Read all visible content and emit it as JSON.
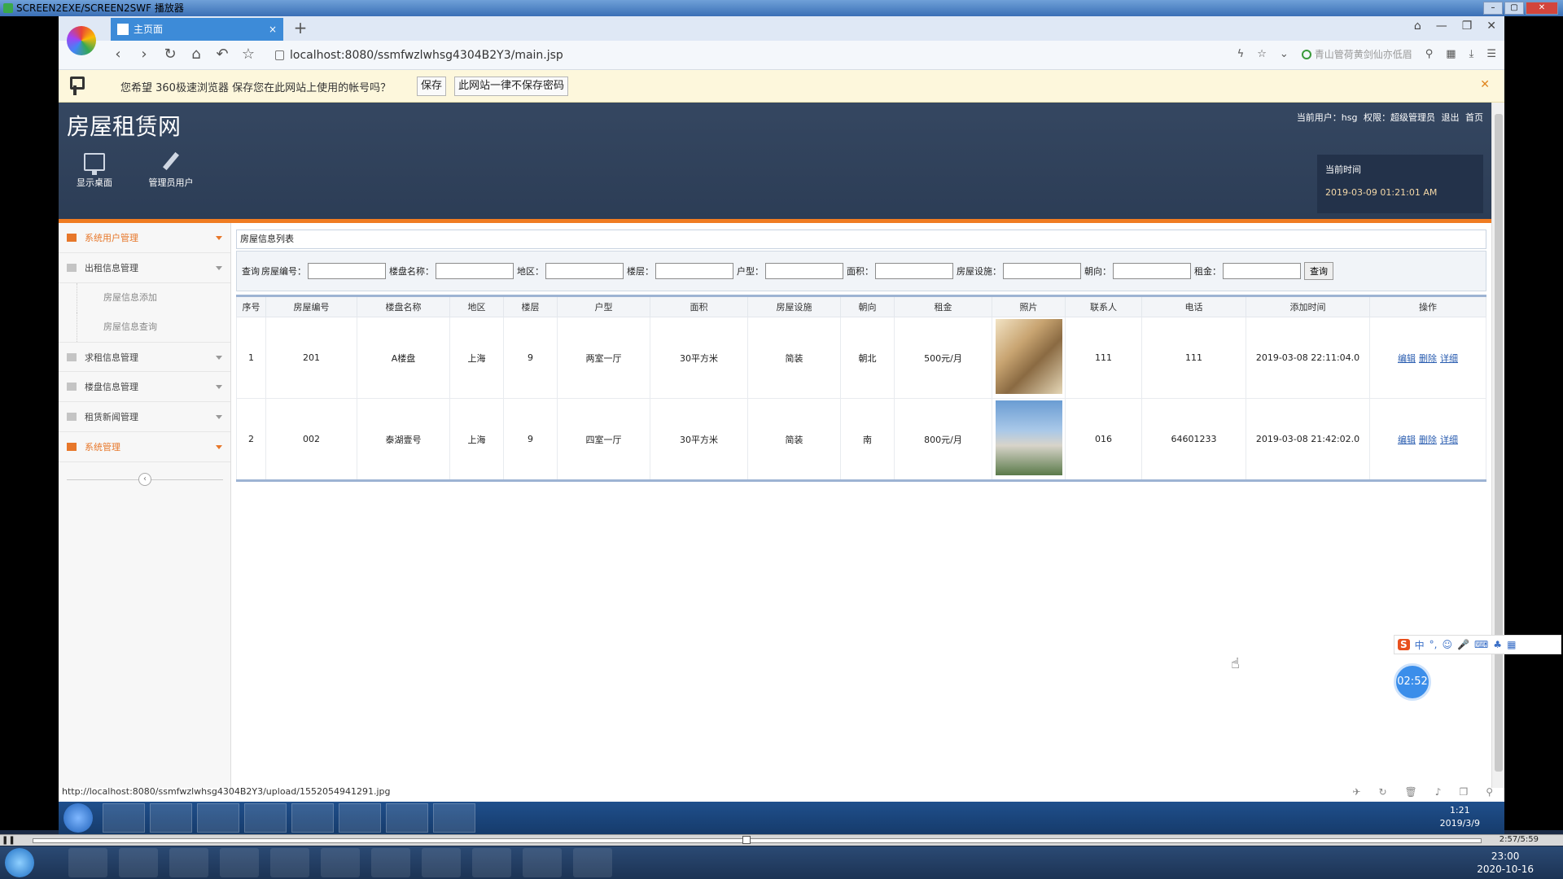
{
  "player": {
    "title": "SCREEN2EXE/SCREEN2SWF 播放器"
  },
  "browser": {
    "tab_title": "主页面",
    "url": "localhost:8080/ssmfwzlwhsg4304B2Y3/main.jsp",
    "search_hint": "青山管荷黄剑仙亦低眉",
    "password_prompt": {
      "message": "您希望 360极速浏览器 保存您在此网站上使用的帐号吗？",
      "save_label": "保存",
      "never_label": "此网站一律不保存密码"
    },
    "status_url": "http://localhost:8080/ssmfwzlwhsg4304B2Y3/upload/1552054941291.jpg"
  },
  "site": {
    "title": "房屋租赁网",
    "user_info": {
      "current_user": "当前用户：hsg",
      "role": "权限：超级管理员",
      "logout": "退出",
      "home": "首页"
    },
    "header_buttons": [
      {
        "label": "显示桌面",
        "icon": "monitor-icon"
      },
      {
        "label": "管理员用户",
        "icon": "pencil-icon"
      }
    ],
    "time_box": {
      "label": "当前时间",
      "value": "2019-03-09 01:21:01 AM"
    }
  },
  "sidebar": {
    "items": [
      {
        "label": "系统用户管理",
        "active": true
      },
      {
        "label": "出租信息管理",
        "active": false
      },
      {
        "label": "求租信息管理",
        "active": false
      },
      {
        "label": "楼盘信息管理",
        "active": false
      },
      {
        "label": "租赁新闻管理",
        "active": false
      },
      {
        "label": "系统管理",
        "active": true
      }
    ],
    "subitems": [
      "房屋信息添加",
      "房屋信息查询"
    ]
  },
  "main": {
    "panel_title": "房屋信息列表",
    "query": {
      "prefix": "查询",
      "fields": [
        "房屋编号：",
        "楼盘名称：",
        "地区：",
        "楼层：",
        "户型：",
        "面积：",
        "房屋设施：",
        "朝向：",
        "租金："
      ],
      "button": "查询"
    },
    "table": {
      "headers": [
        "序号",
        "房屋编号",
        "楼盘名称",
        "地区",
        "楼层",
        "户型",
        "面积",
        "房屋设施",
        "朝向",
        "租金",
        "照片",
        "联系人",
        "电话",
        "添加时间",
        "操作"
      ],
      "rows": [
        {
          "no": "1",
          "code": "201",
          "building": "A楼盘",
          "region": "上海",
          "floor": "9",
          "layout": "两室一厅",
          "area": "30平方米",
          "facility": "简装",
          "orientation": "朝北",
          "rent": "500元/月",
          "contact": "111",
          "phone": "111",
          "added": "2019-03-08 22:11:04.0"
        },
        {
          "no": "2",
          "code": "002",
          "building": "泰湖壹号",
          "region": "上海",
          "floor": "9",
          "layout": "四室一厅",
          "area": "30平方米",
          "facility": "简装",
          "orientation": "南",
          "rent": "800元/月",
          "contact": "016",
          "phone": "64601233",
          "added": "2019-03-08 21:42:02.0"
        }
      ],
      "ops": {
        "edit": "编辑",
        "delete": "删除",
        "detail": "详细"
      }
    }
  },
  "overlay": {
    "timer": "02:52",
    "ime_label": "中"
  },
  "inner_clock": {
    "time": "1:21",
    "date": "2019/3/9"
  },
  "progress": {
    "time": "2:57/5:59",
    "fraction": 0.49
  },
  "os_clock": {
    "time": "23:00",
    "date": "2020-10-16"
  }
}
